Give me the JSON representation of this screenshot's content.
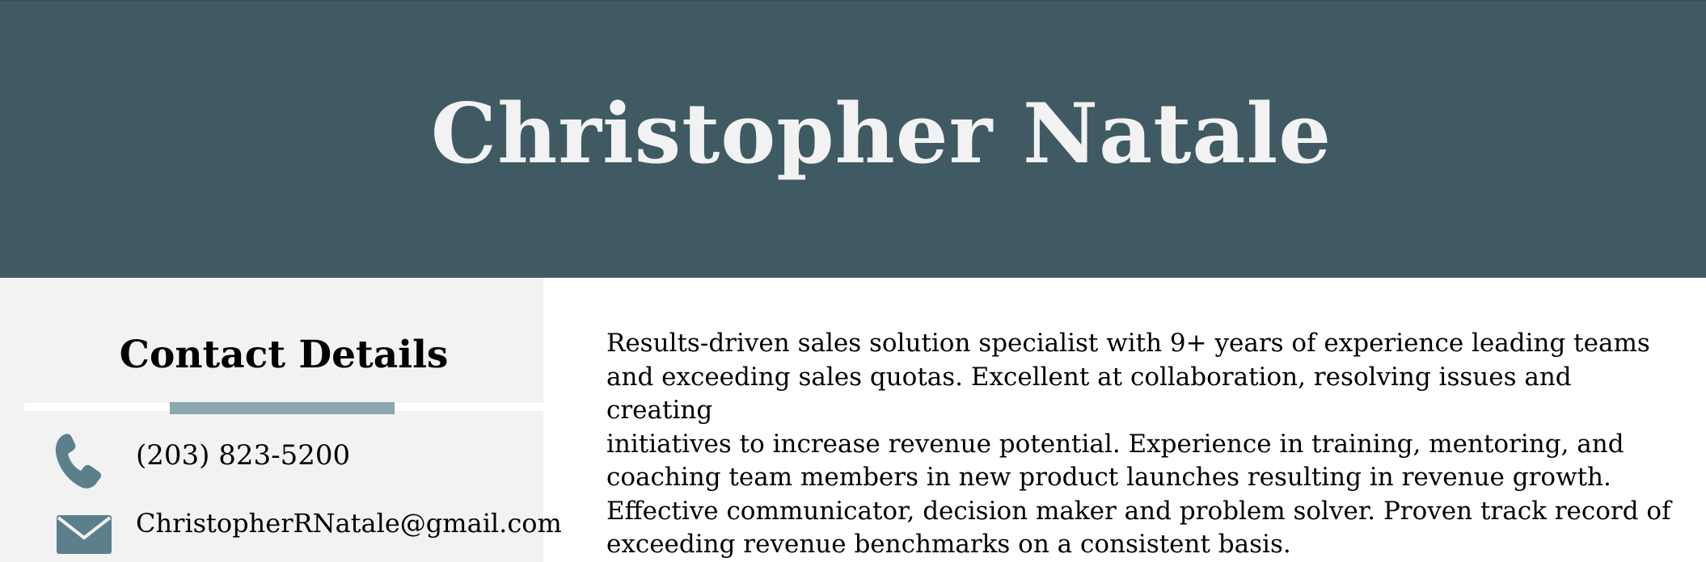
{
  "header": {
    "name": "Christopher Natale"
  },
  "contact": {
    "title": "Contact Details",
    "phone": "(203) 823-5200",
    "email": "ChristopherRNatale@gmail.com",
    "phone_icon": "phone-icon",
    "email_icon": "envelope-icon"
  },
  "summary": {
    "text": "Results-driven sales solution specialist with 9+ years of experience leading teams\nand exceeding sales quotas. Excellent at collaboration, resolving issues and creating\ninitiatives to increase revenue potential. Experience in training, mentoring, and\ncoaching team members in new product launches resulting in revenue growth.\nEffective communicator, decision maker and problem solver. Proven track record of\nexceeding revenue benchmarks on a consistent basis."
  },
  "colors": {
    "header_bg": "#405a63",
    "name_text": "#f2f2f2",
    "sidebar_bg": "#f2f2f2",
    "accent": "#8aa7b2",
    "icon": "#5c7f8c"
  }
}
